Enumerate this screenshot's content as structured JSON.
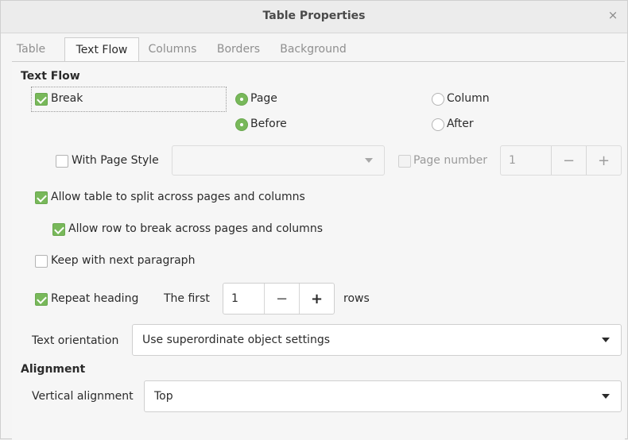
{
  "window": {
    "title": "Table Properties",
    "close_icon": "×"
  },
  "tabs": [
    {
      "label": "Table",
      "active": false
    },
    {
      "label": "Text Flow",
      "active": true
    },
    {
      "label": "Columns",
      "active": false
    },
    {
      "label": "Borders",
      "active": false
    },
    {
      "label": "Background",
      "active": false
    }
  ],
  "text_flow": {
    "heading": "Text Flow",
    "break": {
      "label": "Break",
      "checked": true
    },
    "page_radio": {
      "label": "Page",
      "selected": true
    },
    "column_radio": {
      "label": "Column",
      "selected": false
    },
    "before_radio": {
      "label": "Before",
      "selected": true
    },
    "after_radio": {
      "label": "After",
      "selected": false
    },
    "with_page_style": {
      "label": "With Page Style",
      "checked": false,
      "value": ""
    },
    "page_number": {
      "label": "Page number",
      "checked": false,
      "enabled": false,
      "value": "1",
      "minus": "−",
      "plus": "+"
    },
    "allow_split": {
      "label": "Allow table to split across pages and columns",
      "checked": true
    },
    "allow_row_break": {
      "label": "Allow row to break across pages and columns",
      "checked": true
    },
    "keep_with_next": {
      "label": "Keep with next paragraph",
      "checked": false
    },
    "repeat_heading": {
      "label": "Repeat heading",
      "checked": true,
      "the_first_label": "The first",
      "value": "1",
      "rows_label": "rows",
      "minus": "−",
      "plus": "+"
    },
    "text_orientation": {
      "label": "Text orientation",
      "value": "Use superordinate object settings"
    }
  },
  "alignment": {
    "heading": "Alignment",
    "vertical_alignment": {
      "label": "Vertical alignment",
      "value": "Top"
    }
  }
}
